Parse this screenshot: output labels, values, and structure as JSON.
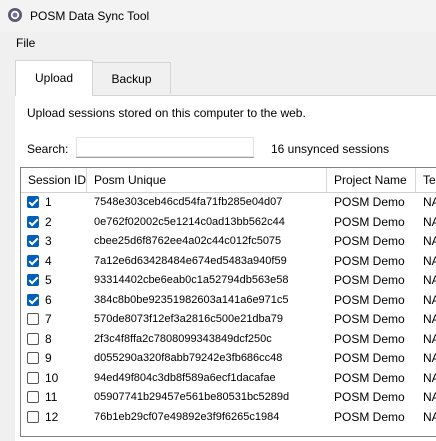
{
  "window": {
    "title": "POSM Data Sync Tool"
  },
  "menu": {
    "file": "File"
  },
  "tabs": {
    "upload": "Upload",
    "backup": "Backup"
  },
  "upload": {
    "description": "Upload sessions stored on this computer to the web.",
    "search_label": "Search:",
    "search_value": "",
    "unsynced_count": "16 unsynced sessions"
  },
  "grid": {
    "headers": [
      "Session ID",
      "Posm Unique",
      "Project Name",
      "Temp"
    ],
    "rows": [
      {
        "checked": true,
        "id": "1",
        "unique": "7548e303ceb46cd54fa71fb285e04d07",
        "project": "POSM Demo",
        "temp": "NASS"
      },
      {
        "checked": true,
        "id": "2",
        "unique": "0e762f02002c5e1214c0ad13bb562c44",
        "project": "POSM Demo",
        "temp": "NASS"
      },
      {
        "checked": true,
        "id": "3",
        "unique": "cbee25d6f8762ee4a02c44c012fc5075",
        "project": "POSM Demo",
        "temp": "NASS"
      },
      {
        "checked": true,
        "id": "4",
        "unique": "7a12e6d63428484e674ed5483a940f59",
        "project": "POSM Demo",
        "temp": "NASS"
      },
      {
        "checked": true,
        "id": "5",
        "unique": "93314402cbe6eab0c1a52794db563e58",
        "project": "POSM Demo",
        "temp": "NASS"
      },
      {
        "checked": true,
        "id": "6",
        "unique": "384c8b0be92351982603a141a6e971c5",
        "project": "POSM Demo",
        "temp": "NASS"
      },
      {
        "checked": false,
        "id": "7",
        "unique": "570de8073f12ef3a2816c500e21dba79",
        "project": "POSM Demo",
        "temp": "NASS"
      },
      {
        "checked": false,
        "id": "8",
        "unique": "2f3c4f8ffa2c7808099343849dcf250c",
        "project": "POSM Demo",
        "temp": "NASS"
      },
      {
        "checked": false,
        "id": "9",
        "unique": "d055290a320f8abb79242e3fb686cc48",
        "project": "POSM Demo",
        "temp": "NASS"
      },
      {
        "checked": false,
        "id": "10",
        "unique": "94ed49f804c3db8f589a6ecf1dacafae",
        "project": "POSM Demo",
        "temp": "NASS"
      },
      {
        "checked": false,
        "id": "11",
        "unique": "05907741b29457e561be80531bc5289d",
        "project": "POSM Demo",
        "temp": "NASS"
      },
      {
        "checked": false,
        "id": "12",
        "unique": "76b1eb29cf07e49892e3f9f6265c1984",
        "project": "POSM Demo",
        "temp": "NASS"
      }
    ]
  },
  "colors": {
    "accent": "#005fb8"
  },
  "icons": {
    "app": "posm-app-icon"
  }
}
